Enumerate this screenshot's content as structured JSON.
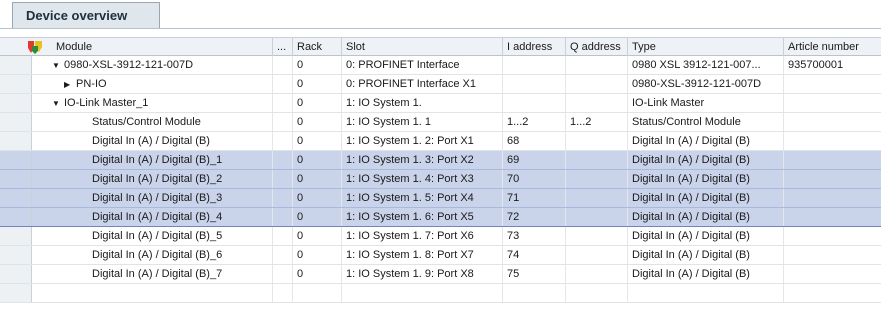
{
  "tab": {
    "label": "Device overview"
  },
  "columns": {
    "module": "Module",
    "ellipsis": "...",
    "rack": "Rack",
    "slot": "Slot",
    "iaddress": "I address",
    "qaddress": "Q address",
    "type": "Type",
    "article": "Article number"
  },
  "rows": [
    {
      "module": "0980-XSL-3912-121-007D",
      "expander": "down",
      "indent": 1,
      "rack": "0",
      "slot": "0: PROFINET Interface",
      "iaddress": "",
      "qaddress": "",
      "type": "0980 XSL 3912-121-007...",
      "article": "935700001",
      "selected": false
    },
    {
      "module": "PN-IO",
      "expander": "right",
      "indent": 2,
      "rack": "0",
      "slot": "0: PROFINET Interface X1",
      "iaddress": "",
      "qaddress": "",
      "type": "0980-XSL-3912-121-007D",
      "article": "",
      "selected": false
    },
    {
      "module": "IO-Link Master_1",
      "expander": "down",
      "indent": 1,
      "rack": "0",
      "slot": "1: IO System 1.",
      "iaddress": "",
      "qaddress": "",
      "type": "IO-Link Master",
      "article": "",
      "selected": false
    },
    {
      "module": "Status/Control Module",
      "expander": "",
      "indent": 3,
      "rack": "0",
      "slot": "1: IO System 1. 1",
      "iaddress": "1...2",
      "qaddress": "1...2",
      "type": "Status/Control Module",
      "article": "",
      "selected": false
    },
    {
      "module": "Digital In (A) / Digital (B)",
      "expander": "",
      "indent": 3,
      "rack": "0",
      "slot": "1: IO System 1. 2: Port X1",
      "iaddress": "68",
      "qaddress": "",
      "type": "Digital In (A) / Digital (B)",
      "article": "",
      "selected": false
    },
    {
      "module": "Digital In (A) / Digital (B)_1",
      "expander": "",
      "indent": 3,
      "rack": "0",
      "slot": "1: IO System 1. 3: Port X2",
      "iaddress": "69",
      "qaddress": "",
      "type": "Digital In (A) / Digital (B)",
      "article": "",
      "selected": true
    },
    {
      "module": "Digital In (A) / Digital (B)_2",
      "expander": "",
      "indent": 3,
      "rack": "0",
      "slot": "1: IO System 1. 4: Port X3",
      "iaddress": "70",
      "qaddress": "",
      "type": "Digital In (A) / Digital (B)",
      "article": "",
      "selected": true
    },
    {
      "module": "Digital In (A) / Digital (B)_3",
      "expander": "",
      "indent": 3,
      "rack": "0",
      "slot": "1: IO System 1. 5: Port X4",
      "iaddress": "71",
      "qaddress": "",
      "type": "Digital In (A) / Digital (B)",
      "article": "",
      "selected": true
    },
    {
      "module": "Digital In (A) / Digital (B)_4",
      "expander": "",
      "indent": 3,
      "rack": "0",
      "slot": "1: IO System 1. 6: Port X5",
      "iaddress": "72",
      "qaddress": "",
      "type": "Digital In (A) / Digital (B)",
      "article": "",
      "selected": true
    },
    {
      "module": "Digital In (A) / Digital (B)_5",
      "expander": "",
      "indent": 3,
      "rack": "0",
      "slot": "1: IO System 1. 7: Port X6",
      "iaddress": "73",
      "qaddress": "",
      "type": "Digital In (A) / Digital (B)",
      "article": "",
      "selected": false
    },
    {
      "module": "Digital In (A) / Digital (B)_6",
      "expander": "",
      "indent": 3,
      "rack": "0",
      "slot": "1: IO System 1. 8: Port X7",
      "iaddress": "74",
      "qaddress": "",
      "type": "Digital In (A) / Digital (B)",
      "article": "",
      "selected": false
    },
    {
      "module": "Digital In (A) / Digital (B)_7",
      "expander": "",
      "indent": 3,
      "rack": "0",
      "slot": "1: IO System 1. 9: Port X8",
      "iaddress": "75",
      "qaddress": "",
      "type": "Digital In (A) / Digital (B)",
      "article": "",
      "selected": false
    },
    {
      "module": "",
      "expander": "",
      "indent": 0,
      "rack": "",
      "slot": "",
      "iaddress": "",
      "qaddress": "",
      "type": "",
      "article": "",
      "selected": false
    }
  ],
  "icons": {
    "header_filter": "filter-icon"
  },
  "colors": {
    "selection": "#c9d3ea",
    "header": "#eef2f6",
    "tab": "#dfe6ec"
  }
}
